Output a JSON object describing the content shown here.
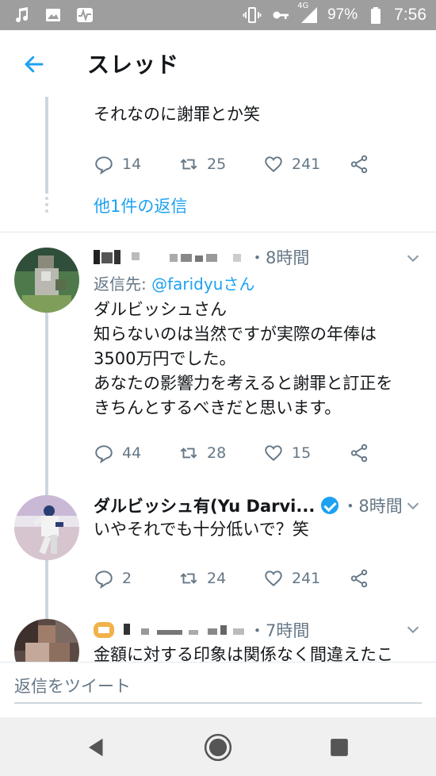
{
  "status_bar": {
    "battery": "97%",
    "time": "7:56",
    "network": "4G",
    "icons": [
      "music-icon",
      "image-icon",
      "activity-icon",
      "vibrate-icon",
      "key-icon",
      "signal-icon",
      "battery-icon"
    ]
  },
  "header": {
    "title": "スレッド",
    "back_icon": "arrow-left-icon"
  },
  "thread": {
    "partial_tweet": {
      "last_line": "それなのに謝罪とか笑",
      "reply_count": "14",
      "retweet_count": "25",
      "like_count": "241"
    },
    "more_replies_label": "他1件の返信",
    "tweets": [
      {
        "time": "・8時間",
        "reply_to_prefix": "返信先: ",
        "reply_to_handle": "@faridyuさん",
        "lines": [
          "ダルビッシュさん",
          "知らないのは当然ですが実際の年俸は",
          "3500万円でした。",
          "あなたの影響力を考えると謝罪と訂正を",
          "きちんとするべきだと思います。"
        ],
        "reply_count": "44",
        "retweet_count": "28",
        "like_count": "15"
      },
      {
        "name": "ダルビッシュ有(Yu Darvi...",
        "time": "・8時間",
        "lines": [
          "いやそれでも十分低いで？笑"
        ],
        "reply_count": "2",
        "retweet_count": "24",
        "like_count": "241"
      },
      {
        "time": "・7時間",
        "lines": [
          "金額に対する印象は関係なく間違えたこ"
        ]
      }
    ]
  },
  "compose": {
    "placeholder": "返信をツイート"
  },
  "colors": {
    "accent": "#1da1f2",
    "muted": "#657786",
    "status_bar": "#9e9e9e"
  }
}
